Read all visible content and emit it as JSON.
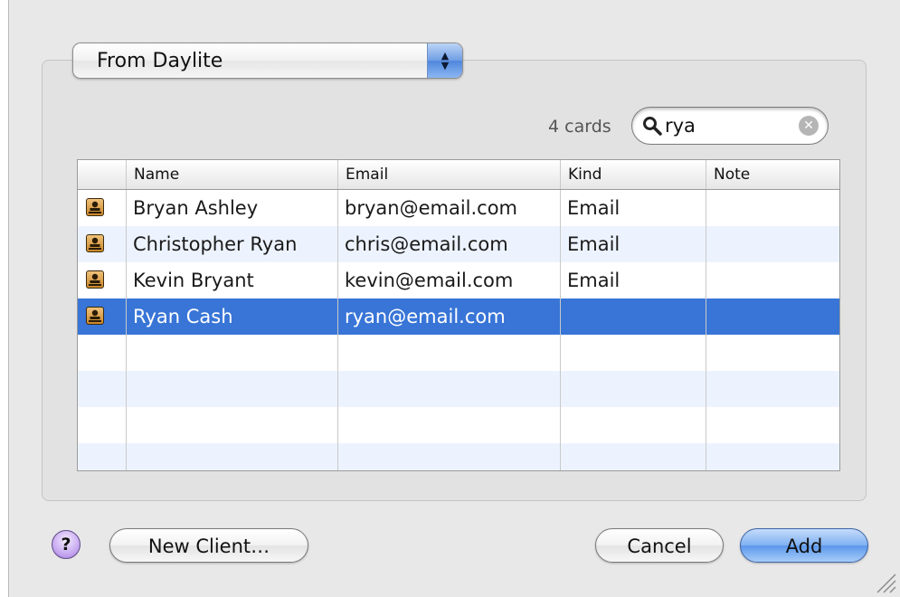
{
  "source_popup": {
    "selected": "From Daylite"
  },
  "results": {
    "count_label": "4 cards"
  },
  "search": {
    "value": "rya",
    "clear_glyph": "✕",
    "icon": "search-icon"
  },
  "table": {
    "columns": [
      "Name",
      "Email",
      "Kind",
      "Note"
    ],
    "rows": [
      {
        "icon": "contact-card-icon",
        "name": "Bryan Ashley",
        "email": "bryan@email.com",
        "kind": "Email",
        "note": ""
      },
      {
        "icon": "contact-card-icon",
        "name": "Christopher Ryan",
        "email": "chris@email.com",
        "kind": "Email",
        "note": ""
      },
      {
        "icon": "contact-card-icon",
        "name": "Kevin Bryant",
        "email": "kevin@email.com",
        "kind": "Email",
        "note": ""
      },
      {
        "icon": "contact-card-icon",
        "name": "Ryan Cash",
        "email": "ryan@email.com",
        "kind": "",
        "note": "",
        "selected": true
      }
    ]
  },
  "buttons": {
    "help": "?",
    "new_client": "New Client…",
    "cancel": "Cancel",
    "add": "Add"
  },
  "colors": {
    "selection": "#3875d7",
    "alt_row": "#edf3fe",
    "default_button": "#5a97ec"
  }
}
